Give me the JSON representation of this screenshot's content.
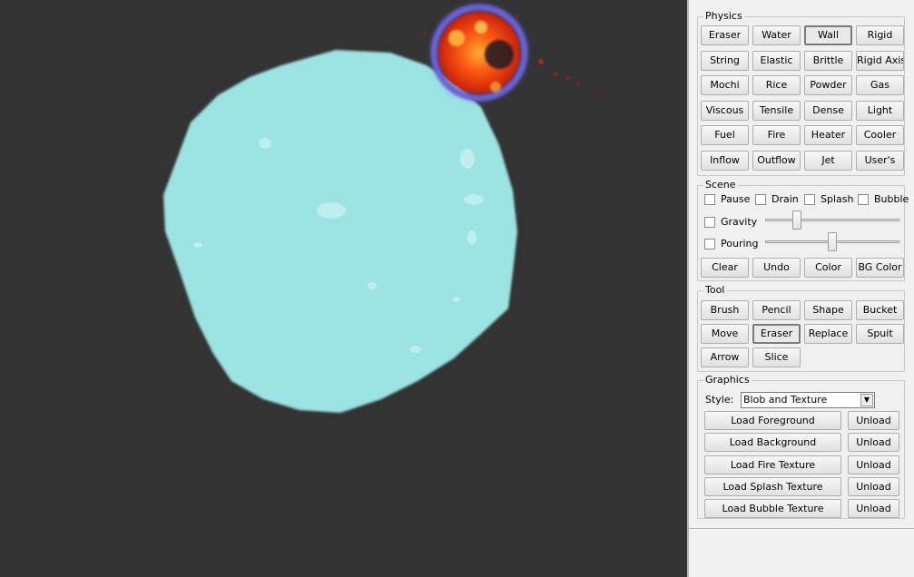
{
  "physics": {
    "title": "Physics",
    "buttons": [
      "Eraser",
      "Water",
      "Wall",
      "Rigid",
      "String",
      "Elastic",
      "Brittle",
      "Rigid Axis",
      "Mochi",
      "Rice",
      "Powder",
      "Gas",
      "Viscous",
      "Tensile",
      "Dense",
      "Light",
      "Fuel",
      "Fire",
      "Heater",
      "Cooler",
      "Inflow",
      "Outflow",
      "Jet",
      "User's"
    ],
    "selected": "Wall"
  },
  "scene": {
    "title": "Scene",
    "pause": "Pause",
    "drain": "Drain",
    "splash": "Splash",
    "bubble": "Bubble",
    "gravity": "Gravity",
    "pouring": "Pouring",
    "gravity_level": 0.22,
    "pouring_level": 0.5,
    "clear": "Clear",
    "undo": "Undo",
    "color": "Color",
    "bg_color": "BG Color"
  },
  "tool": {
    "title": "Tool",
    "buttons": [
      "Brush",
      "Pencil",
      "Shape",
      "Bucket",
      "Move",
      "Eraser",
      "Replace",
      "Spuit",
      "Arrow",
      "Slice"
    ],
    "selected": "Eraser"
  },
  "graphics": {
    "title": "Graphics",
    "style_label": "Style:",
    "style_value": "Blob and Texture",
    "load_foreground": "Load Foreground",
    "load_background": "Load Background",
    "load_fire_texture": "Load Fire Texture",
    "load_splash_texture": "Load Splash Texture",
    "load_bubble_texture": "Load Bubble Texture",
    "unload": "Unload"
  },
  "colors": {
    "canvas_bg": "#333333",
    "water_blob": "#9ce3e3",
    "fire_core": "#ff5a14",
    "fire_ring": "#6a62d8"
  }
}
